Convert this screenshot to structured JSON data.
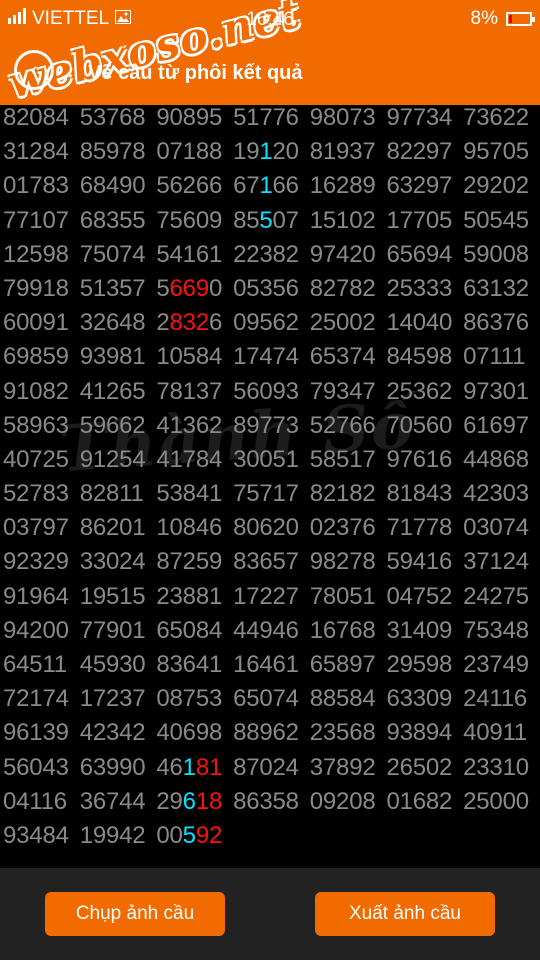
{
  "status": {
    "carrier": "VIETTEL",
    "time": "16:46",
    "battery": "8%"
  },
  "toolbar": {
    "title": "Vẽ cầu từ phôi kết quả",
    "watermark": "webxoso.net"
  },
  "background_watermark": "Thành Số",
  "grid": [
    [
      [
        "82084"
      ],
      [
        "53768"
      ],
      [
        "90895"
      ],
      [
        "51776"
      ],
      [
        "98073"
      ],
      [
        "97734"
      ],
      [
        "73622"
      ]
    ],
    [
      [
        "31284"
      ],
      [
        "85978"
      ],
      [
        "07188"
      ],
      [
        [
          "19",
          ""
        ],
        [
          "1",
          "cyan"
        ],
        [
          "20",
          ""
        ]
      ],
      [
        "81937"
      ],
      [
        "82297"
      ],
      [
        "95705"
      ]
    ],
    [
      [
        "01783"
      ],
      [
        "68490"
      ],
      [
        "56266"
      ],
      [
        [
          "67",
          ""
        ],
        [
          "1",
          "cyan"
        ],
        [
          "66",
          ""
        ]
      ],
      [
        "16289"
      ],
      [
        "63297"
      ],
      [
        "29202"
      ]
    ],
    [
      [
        "77107"
      ],
      [
        "68355"
      ],
      [
        "75609"
      ],
      [
        [
          "85",
          ""
        ],
        [
          "5",
          "cyan"
        ],
        [
          "07",
          ""
        ]
      ],
      [
        "15102"
      ],
      [
        "17705"
      ],
      [
        "50545"
      ]
    ],
    [
      [
        "12598"
      ],
      [
        "75074"
      ],
      [
        "54161"
      ],
      [
        "22382"
      ],
      [
        "97420"
      ],
      [
        "65694"
      ],
      [
        "59008"
      ]
    ],
    [
      [
        "79918"
      ],
      [
        "51357"
      ],
      [
        [
          "5",
          ""
        ],
        [
          "669",
          "red"
        ],
        [
          "0",
          ""
        ]
      ],
      [
        "05356"
      ],
      [
        "82782"
      ],
      [
        "25333"
      ],
      [
        "63132"
      ]
    ],
    [
      [
        "60091"
      ],
      [
        "32648"
      ],
      [
        [
          "2",
          ""
        ],
        [
          "832",
          "red"
        ],
        [
          "6",
          ""
        ]
      ],
      [
        "09562"
      ],
      [
        "25002"
      ],
      [
        "14040"
      ],
      [
        "86376"
      ]
    ],
    [
      [
        "69859"
      ],
      [
        "93981"
      ],
      [
        "10584"
      ],
      [
        "17474"
      ],
      [
        "65374"
      ],
      [
        "84598"
      ],
      [
        "07111"
      ]
    ],
    [
      [
        "91082"
      ],
      [
        "41265"
      ],
      [
        "78137"
      ],
      [
        "56093"
      ],
      [
        "79347"
      ],
      [
        "25362"
      ],
      [
        "97301"
      ]
    ],
    [
      [
        "58963"
      ],
      [
        "59662"
      ],
      [
        "41362"
      ],
      [
        "89773"
      ],
      [
        "52766"
      ],
      [
        "70560"
      ],
      [
        "61697"
      ]
    ],
    [
      [
        "40725"
      ],
      [
        "91254"
      ],
      [
        "41784"
      ],
      [
        "30051"
      ],
      [
        "58517"
      ],
      [
        "97616"
      ],
      [
        "44868"
      ]
    ],
    [
      [
        "52783"
      ],
      [
        "82811"
      ],
      [
        "53841"
      ],
      [
        "75717"
      ],
      [
        "82182"
      ],
      [
        "81843"
      ],
      [
        "42303"
      ]
    ],
    [
      [
        "03797"
      ],
      [
        "86201"
      ],
      [
        "10846"
      ],
      [
        "80620"
      ],
      [
        "02376"
      ],
      [
        "71778"
      ],
      [
        "03074"
      ]
    ],
    [
      [
        "92329"
      ],
      [
        "33024"
      ],
      [
        "87259"
      ],
      [
        "83657"
      ],
      [
        "98278"
      ],
      [
        "59416"
      ],
      [
        "37124"
      ]
    ],
    [
      [
        "91964"
      ],
      [
        "19515"
      ],
      [
        "23881"
      ],
      [
        "17227"
      ],
      [
        "78051"
      ],
      [
        "04752"
      ],
      [
        "24275"
      ]
    ],
    [
      [
        "94200"
      ],
      [
        "77901"
      ],
      [
        "65084"
      ],
      [
        "44946"
      ],
      [
        "16768"
      ],
      [
        "31409"
      ],
      [
        "75348"
      ]
    ],
    [
      [
        "64511"
      ],
      [
        "45930"
      ],
      [
        "83641"
      ],
      [
        "16461"
      ],
      [
        "65897"
      ],
      [
        "29598"
      ],
      [
        "23749"
      ]
    ],
    [
      [
        "72174"
      ],
      [
        "17237"
      ],
      [
        "08753"
      ],
      [
        "65074"
      ],
      [
        "88584"
      ],
      [
        "63309"
      ],
      [
        "24116"
      ]
    ],
    [
      [
        "96139"
      ],
      [
        "42342"
      ],
      [
        "40698"
      ],
      [
        "88962"
      ],
      [
        "23568"
      ],
      [
        "93894"
      ],
      [
        "40911"
      ]
    ],
    [
      [
        "56043"
      ],
      [
        "63990"
      ],
      [
        [
          "46",
          ""
        ],
        [
          "1",
          "cyan"
        ],
        [
          "81",
          "red"
        ]
      ],
      [
        "87024"
      ],
      [
        "37892"
      ],
      [
        "26502"
      ],
      [
        "23310"
      ]
    ],
    [
      [
        "04116"
      ],
      [
        "36744"
      ],
      [
        [
          "29",
          ""
        ],
        [
          "6",
          "cyan"
        ],
        [
          "18",
          "red"
        ]
      ],
      [
        "86358"
      ],
      [
        "09208"
      ],
      [
        "01682"
      ],
      [
        "25000"
      ]
    ],
    [
      [
        "93484"
      ],
      [
        "19942"
      ],
      [
        [
          "00",
          ""
        ],
        [
          "5",
          "cyan"
        ],
        [
          "92",
          "red"
        ]
      ]
    ]
  ],
  "footer": {
    "capture_label": "Chụp ảnh cầu",
    "export_label": "Xuất ảnh cầu"
  }
}
